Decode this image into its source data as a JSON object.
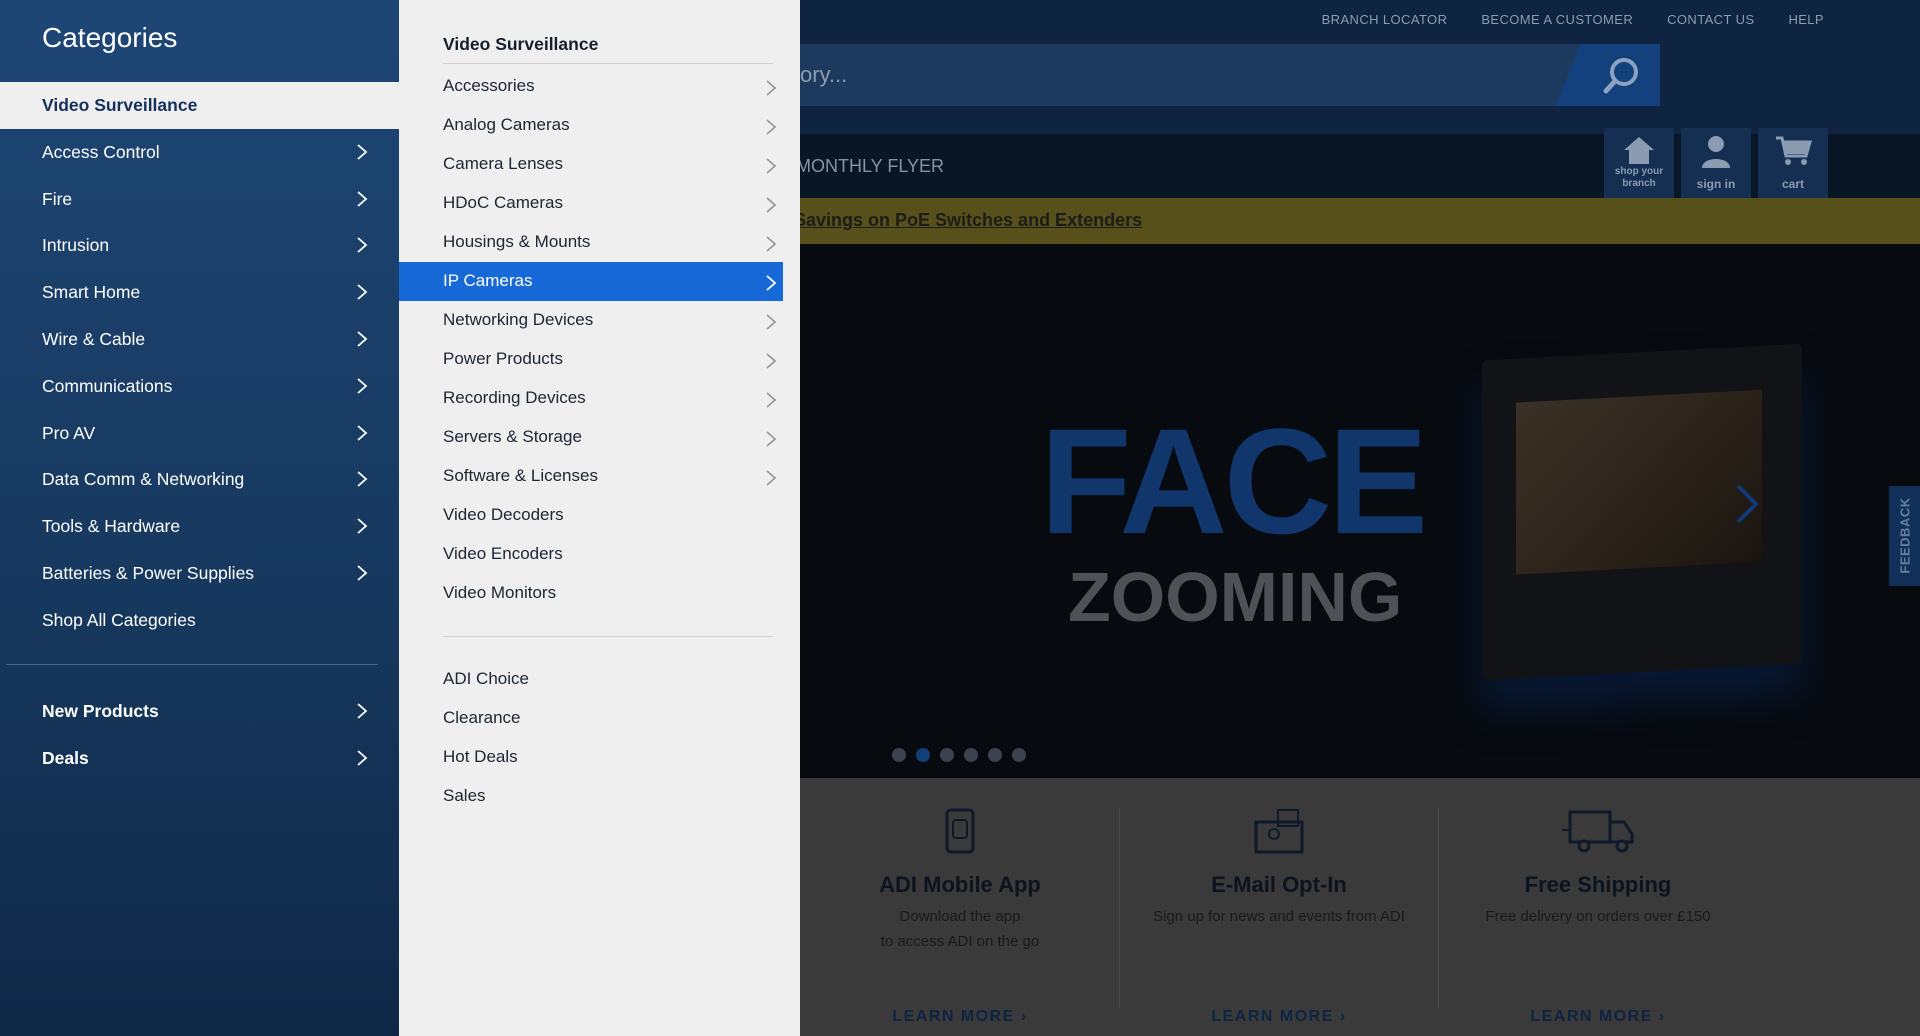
{
  "background": {
    "top_links": [
      "BRANCH LOCATOR",
      "BECOME A CUSTOMER",
      "CONTACT US",
      "HELP"
    ],
    "search_placeholder_visible": "ory...",
    "nav_partial_label": "MONTHLY FLYER",
    "nav_buttons": [
      {
        "label": "shop your branch",
        "icon": "home-icon"
      },
      {
        "label": "sign in",
        "icon": "user-icon"
      },
      {
        "label": "cart",
        "icon": "cart-icon"
      }
    ],
    "promo_text": "Savings on PoE Switches and Extenders",
    "hero": {
      "headline": "FACE",
      "subheadline": "ZOOMING",
      "slide_count": 6,
      "active_slide": 2
    },
    "feedback_label": "FEEDBACK",
    "info_cards": [
      {
        "title": "ADI Mobile App",
        "desc": [
          "Download the app",
          "to access ADI on the go"
        ],
        "link": "LEARN MORE",
        "icon": "phone-icon"
      },
      {
        "title": "E-Mail Opt-In",
        "desc": [
          "Sign up for news and events from ADI"
        ],
        "link": "LEARN MORE",
        "icon": "email-icon"
      },
      {
        "title": "Free Shipping",
        "desc": [
          "Free delivery on orders over £150"
        ],
        "link": "LEARN MORE",
        "icon": "truck-icon"
      }
    ]
  },
  "sidebar": {
    "heading": "Categories",
    "items": [
      {
        "label": "Video Surveillance",
        "active": true,
        "chevron": false
      },
      {
        "label": "Access Control",
        "chevron": true
      },
      {
        "label": "Fire",
        "chevron": true
      },
      {
        "label": "Intrusion",
        "chevron": true
      },
      {
        "label": "Smart Home",
        "chevron": true
      },
      {
        "label": "Wire & Cable",
        "chevron": true
      },
      {
        "label": "Communications",
        "chevron": true
      },
      {
        "label": "Pro AV",
        "chevron": true
      },
      {
        "label": "Data Comm & Networking",
        "chevron": true
      },
      {
        "label": "Tools & Hardware",
        "chevron": true
      },
      {
        "label": "Batteries & Power Supplies",
        "chevron": true
      },
      {
        "label": "Shop All Categories",
        "chevron": false
      }
    ],
    "extra_items": [
      {
        "label": "New Products",
        "chevron": true
      },
      {
        "label": "Deals",
        "chevron": true
      }
    ]
  },
  "subpanel": {
    "title": "Video Surveillance",
    "items": [
      {
        "label": "Accessories",
        "chevron": true
      },
      {
        "label": "Analog Cameras",
        "chevron": true
      },
      {
        "label": "Camera Lenses",
        "chevron": true
      },
      {
        "label": "HDoC Cameras",
        "chevron": true
      },
      {
        "label": "Housings & Mounts",
        "chevron": true
      },
      {
        "label": "IP Cameras",
        "chevron": true,
        "active": true
      },
      {
        "label": "Networking Devices",
        "chevron": true
      },
      {
        "label": "Power Products",
        "chevron": true
      },
      {
        "label": "Recording Devices",
        "chevron": true
      },
      {
        "label": "Servers & Storage",
        "chevron": true
      },
      {
        "label": "Software & Licenses",
        "chevron": true
      },
      {
        "label": "Video Decoders",
        "chevron": false
      },
      {
        "label": "Video Encoders",
        "chevron": false
      },
      {
        "label": "Video Monitors",
        "chevron": false
      }
    ],
    "extra_items": [
      {
        "label": "ADI Choice"
      },
      {
        "label": "Clearance"
      },
      {
        "label": "Hot Deals"
      },
      {
        "label": "Sales"
      }
    ]
  }
}
